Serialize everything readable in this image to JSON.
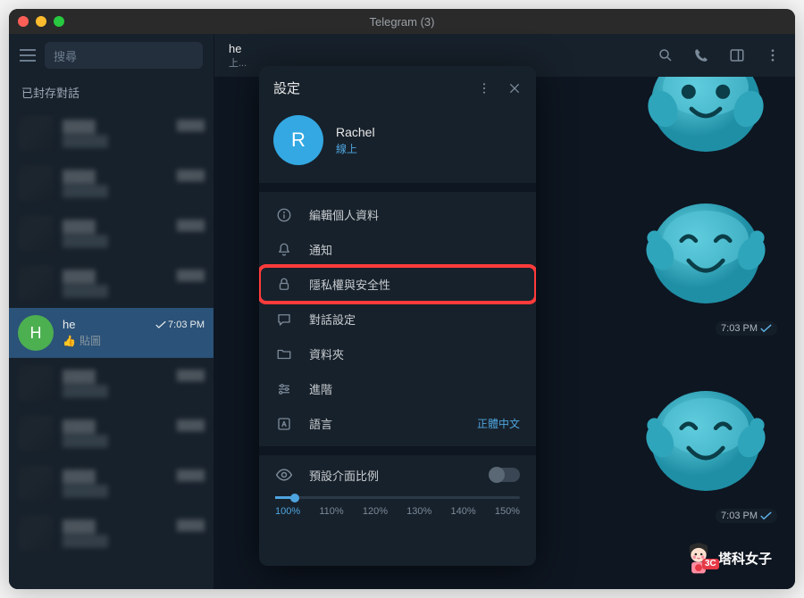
{
  "window": {
    "title": "Telegram (3)"
  },
  "sidebar": {
    "search_placeholder": "搜尋",
    "archive_label": "已封存對話",
    "active_chat": {
      "avatar_letter": "H",
      "avatar_color": "#4caf50",
      "name": "he",
      "time": "7:03 PM",
      "preview_emoji": "👍",
      "preview_label": "貼圖"
    }
  },
  "chat_header": {
    "name": "he",
    "status": "上..."
  },
  "messages": {
    "sticker_time": "7:03 PM"
  },
  "settings_panel": {
    "title": "設定",
    "profile": {
      "avatar_letter": "R",
      "name": "Rachel",
      "status": "線上"
    },
    "items": [
      {
        "icon": "info",
        "label": "編輯個人資料"
      },
      {
        "icon": "bell",
        "label": "通知"
      },
      {
        "icon": "lock",
        "label": "隱私權與安全性",
        "highlight": true
      },
      {
        "icon": "chat",
        "label": "對話設定"
      },
      {
        "icon": "folder",
        "label": "資料夾"
      },
      {
        "icon": "advanced",
        "label": "進階"
      },
      {
        "icon": "lang",
        "label": "語言",
        "value": "正體中文"
      }
    ],
    "scale": {
      "label": "預設介面比例",
      "options": [
        "100%",
        "110%",
        "120%",
        "130%",
        "140%",
        "150%"
      ],
      "active_index": 0
    }
  },
  "watermark": {
    "text": "塔科女子",
    "badge": "3C"
  }
}
